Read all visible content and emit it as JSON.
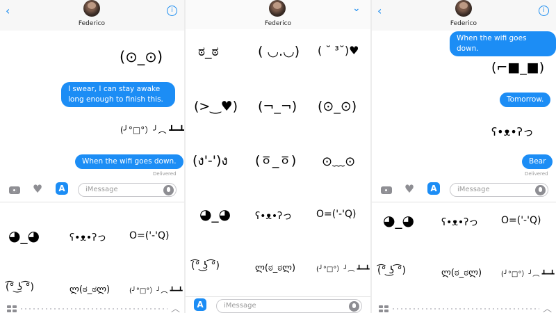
{
  "contact_name": "Federico",
  "composer_placeholder": "iMessage",
  "delivered_label": "Delivered",
  "accent": "#1c8df5",
  "icons": {
    "back": "chevron-left-icon",
    "info": "info-icon",
    "collapse": "chevron-down-icon",
    "camera": "camera-icon",
    "digital_touch": "heart-hand-icon",
    "app_store": "app-store-icon",
    "mic": "microphone-icon",
    "app_grid": "app-grid-icon",
    "expand": "chevron-up-icon"
  },
  "panel1": {
    "messages": [
      {
        "kind": "emote",
        "text": "(⊙_⊙)"
      },
      {
        "kind": "bubble",
        "text": "I swear, I can stay awake long enough to finish this."
      },
      {
        "kind": "emote",
        "text": "(╯°□°）╯︵ ┻━┻"
      },
      {
        "kind": "bubble",
        "text": "When the wifi goes down."
      }
    ],
    "drawer": [
      "◕_◕",
      "ʕ•ᴥ•ʔっ",
      "O=('-'Q)",
      "(͡° ͜ʖ ͡°)",
      "ლ(ಠ_ಠლ)",
      "(╯°□°）╯︵ ┻━┻"
    ]
  },
  "panel2": {
    "grid": [
      "ಠ_ಠ",
      "( ◡.◡)",
      "( ˘ ³˘)♥",
      "(>‿♥)",
      "(¬_¬)",
      "(⊙_⊙)",
      "(ง'-')ง",
      "(ㆆ_ㆆ)",
      "⊙﹏⊙",
      "◕_◕",
      "ʕ•ᴥ•ʔっ",
      "O=('-'Q)",
      "(͡° ͜ʖ ͡°)",
      "ლ(ಠ_ಠლ)",
      "(╯°□°）╯︵ ┻━┻"
    ]
  },
  "panel3": {
    "messages": [
      {
        "kind": "bubble",
        "text": "When the wifi goes down."
      },
      {
        "kind": "emote",
        "text": "(⌐■_■)"
      },
      {
        "kind": "bubble",
        "text": "Tomorrow."
      },
      {
        "kind": "emote",
        "text": "ʕ•ᴥ•ʔっ"
      },
      {
        "kind": "bubble",
        "text": "Bear"
      }
    ],
    "drawer": [
      "◕_◕",
      "ʕ•ᴥ•ʔっ",
      "O=('-'Q)",
      "(͡° ͜ʖ ͡°)",
      "ლ(ಠ_ಠლ)",
      "(╯°□°）╯︵ ┻━┻"
    ]
  }
}
